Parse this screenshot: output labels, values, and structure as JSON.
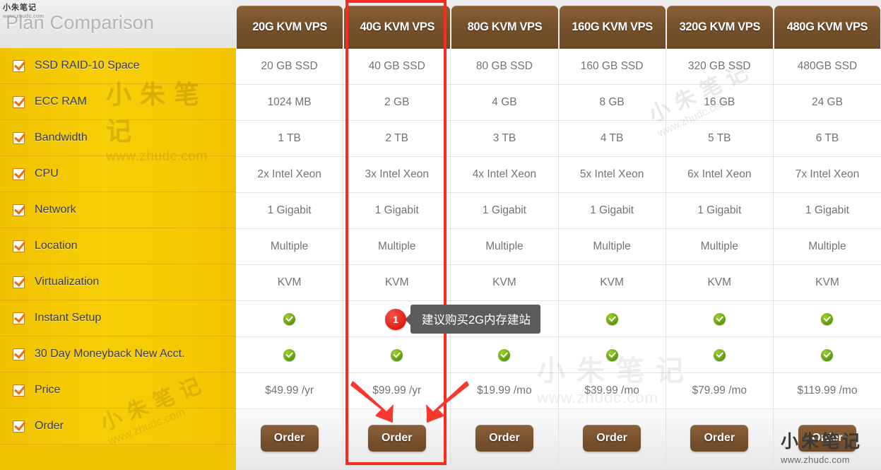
{
  "sidebar": {
    "title": "Plan Comparison",
    "features": [
      {
        "label": "SSD RAID-10 Space",
        "icon": "checkbox-checked-icon"
      },
      {
        "label": "ECC RAM",
        "icon": "checkbox-checked-icon"
      },
      {
        "label": "Bandwidth",
        "icon": "checkbox-checked-icon"
      },
      {
        "label": "CPU",
        "icon": "checkbox-checked-icon"
      },
      {
        "label": "Network",
        "icon": "checkbox-checked-icon"
      },
      {
        "label": "Location",
        "icon": "checkbox-checked-icon"
      },
      {
        "label": "Virtualization",
        "icon": "checkbox-checked-icon"
      },
      {
        "label": "Instant Setup",
        "icon": "checkbox-checked-icon"
      },
      {
        "label": "30 Day Moneyback New Acct.",
        "icon": "checkbox-checked-icon"
      },
      {
        "label": "Price",
        "icon": "checkbox-checked-icon"
      },
      {
        "label": "Order",
        "icon": "checkbox-checked-icon"
      }
    ]
  },
  "table": {
    "row_keys": [
      "ssd",
      "ram",
      "bandwidth",
      "cpu",
      "network",
      "location",
      "virtualization",
      "instant_setup",
      "moneyback",
      "price",
      "order"
    ],
    "plans": [
      {
        "name": "20G KVM VPS",
        "ssd": "20 GB SSD",
        "ram": "1024 MB",
        "bandwidth": "1 TB",
        "cpu": "2x Intel Xeon",
        "network": "1 Gigabit",
        "location": "Multiple",
        "virtualization": "KVM",
        "instant_setup": "yes",
        "moneyback": "yes",
        "price": "$49.99 /yr",
        "order_label": "Order",
        "highlighted": false
      },
      {
        "name": "40G KVM VPS",
        "ssd": "40 GB SSD",
        "ram": "2 GB",
        "bandwidth": "2 TB",
        "cpu": "3x Intel Xeon",
        "network": "1 Gigabit",
        "location": "Multiple",
        "virtualization": "KVM",
        "instant_setup": "yes",
        "moneyback": "yes",
        "price": "$99.99 /yr",
        "order_label": "Order",
        "highlighted": true
      },
      {
        "name": "80G KVM VPS",
        "ssd": "80 GB SSD",
        "ram": "4 GB",
        "bandwidth": "3 TB",
        "cpu": "4x Intel Xeon",
        "network": "1 Gigabit",
        "location": "Multiple",
        "virtualization": "KVM",
        "instant_setup": "yes",
        "moneyback": "yes",
        "price": "$19.99 /mo",
        "order_label": "Order",
        "highlighted": false
      },
      {
        "name": "160G KVM VPS",
        "ssd": "160 GB SSD",
        "ram": "8 GB",
        "bandwidth": "4 TB",
        "cpu": "5x Intel Xeon",
        "network": "1 Gigabit",
        "location": "Multiple",
        "virtualization": "KVM",
        "instant_setup": "yes",
        "moneyback": "yes",
        "price": "$39.99 /mo",
        "order_label": "Order",
        "highlighted": false
      },
      {
        "name": "320G KVM VPS",
        "ssd": "320 GB SSD",
        "ram": "16 GB",
        "bandwidth": "5 TB",
        "cpu": "6x Intel Xeon",
        "network": "1 Gigabit",
        "location": "Multiple",
        "virtualization": "KVM",
        "instant_setup": "yes",
        "moneyback": "yes",
        "price": "$79.99 /mo",
        "order_label": "Order",
        "highlighted": false
      },
      {
        "name": "480G KVM VPS",
        "ssd": "480GB SSD",
        "ram": "24 GB",
        "bandwidth": "6 TB",
        "cpu": "7x Intel Xeon",
        "network": "1 Gigabit",
        "location": "Multiple",
        "virtualization": "KVM",
        "instant_setup": "yes",
        "moneyback": "yes",
        "price": "$119.99 /mo",
        "order_label": "Order",
        "highlighted": false
      }
    ]
  },
  "annotation": {
    "badge_number": "1",
    "text": "建议购买2G内存建站",
    "highlight_color": "#fc2b20",
    "bubble_color": "#5c5c5c",
    "badge_color": "#e4231a",
    "arrow_count": 2
  },
  "watermarks": {
    "cn": "小朱笔记",
    "url": "www.zhudc.com"
  },
  "colors": {
    "sidebar_yellow": "#f0c400",
    "header_brown": "#76522c",
    "check_green": "#6aa80f",
    "text_gray": "#737373"
  }
}
